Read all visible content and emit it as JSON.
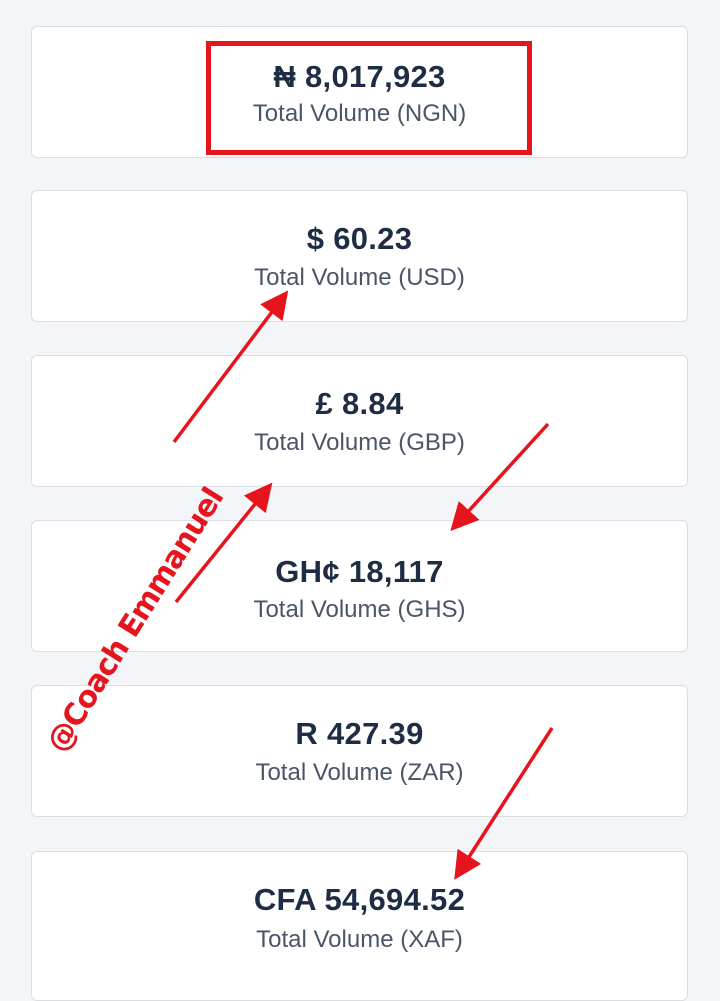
{
  "cards": [
    {
      "id": "ngn",
      "amount": "₦ 8,017,923",
      "label": "Total Volume (NGN)"
    },
    {
      "id": "usd",
      "amount": "$ 60.23",
      "label": "Total Volume (USD)"
    },
    {
      "id": "gbp",
      "amount": "£ 8.84",
      "label": "Total Volume (GBP)"
    },
    {
      "id": "ghs",
      "amount": "GH¢ 18,117",
      "label": "Total Volume (GHS)"
    },
    {
      "id": "zar",
      "amount": "R 427.39",
      "label": "Total Volume (ZAR)"
    },
    {
      "id": "xaf",
      "amount": "CFA 54,694.52",
      "label": "Total Volume (XAF)"
    }
  ],
  "annotations": {
    "watermark": "@Coach Emmanuel",
    "accent_color": "#e6141c",
    "arrow_icon": "red-arrow-icon"
  }
}
